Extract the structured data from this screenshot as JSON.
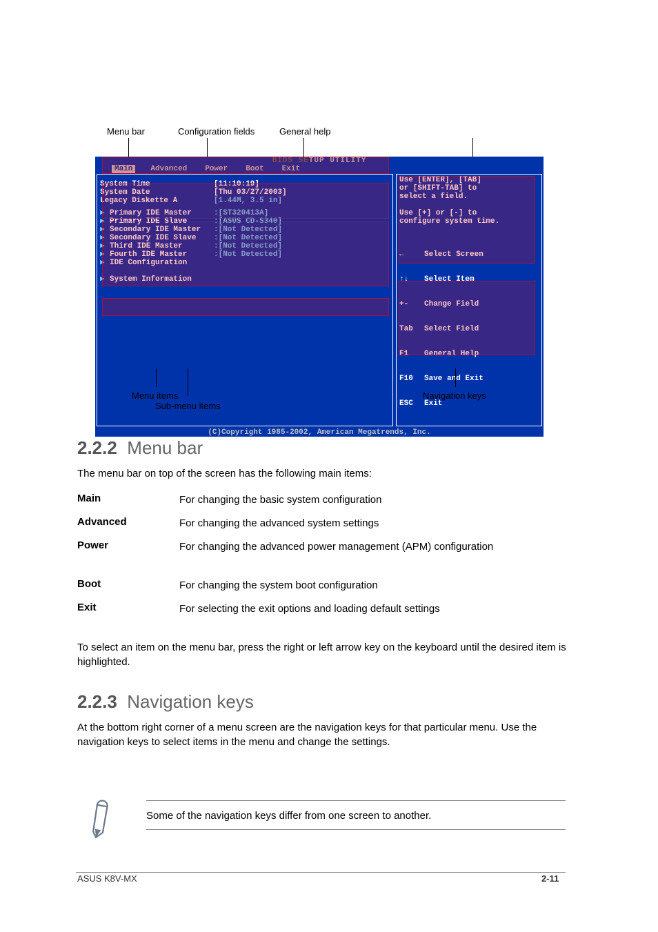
{
  "bios": {
    "title": "BIOS SETUP UTILITY",
    "menu": {
      "items": [
        "Main",
        "Advanced",
        "Power",
        "Boot",
        "Exit"
      ],
      "selected": 0
    },
    "rows_general": [
      {
        "label": "System Time",
        "value": "[11:10:19]"
      },
      {
        "label": "System Date",
        "value": "[Thu 03/27/2003]"
      },
      {
        "label": "Legacy Diskette A",
        "value": "[1.44M, 3.5 in]"
      }
    ],
    "rows_config": [
      {
        "label": "Primary IDE Master",
        "value": ":[ST320413A]"
      },
      {
        "label": "Primary IDE Slave",
        "value": ":[ASUS CD-S340]"
      },
      {
        "label": "Secondary IDE Master",
        "value": ":[Not Detected]"
      },
      {
        "label": "Secondary IDE Slave",
        "value": ":[Not Detected]"
      },
      {
        "label": "Third IDE Master",
        "value": ":[Not Detected]"
      },
      {
        "label": "Fourth IDE Master",
        "value": ":[Not Detected]"
      },
      {
        "label": "IDE Configuration",
        "value": ""
      }
    ],
    "rows_submenu": [
      {
        "label": "System Information",
        "value": ""
      }
    ],
    "help": "Use [ENTER], [TAB]\nor [SHIFT-TAB] to\nselect a field.\n\nUse [+] or [-] to\nconfigure system time.",
    "keys": [
      {
        "k": "←",
        "d": "Select Screen"
      },
      {
        "k": "↑↓",
        "d": "Select Item"
      },
      {
        "k": "+-",
        "d": "Change Field"
      },
      {
        "k": "Tab",
        "d": "Select Field"
      },
      {
        "k": "F1",
        "d": "General Help"
      },
      {
        "k": "F10",
        "d": "Save and Exit"
      },
      {
        "k": "ESC",
        "d": "Exit"
      }
    ],
    "footer": "(C)Copyright 1985-2002, American Megatrends, Inc."
  },
  "callouts": {
    "menubar": "Menu bar",
    "general_help": "General help",
    "config": "Configuration fields",
    "menu_items": "Menu items",
    "submenu": "Sub-menu items",
    "navkeys": "Navigation keys"
  },
  "section": {
    "num": "2.2.2",
    "title": "Menu bar",
    "intro": "The menu bar on top of the screen has the following main items:",
    "items": [
      {
        "name": "Main",
        "desc": "For changing the basic system configuration"
      },
      {
        "name": "Advanced",
        "desc": "For changing the advanced system settings"
      },
      {
        "name": "Power",
        "desc": "For changing the advanced power management (APM) configuration"
      },
      {
        "name": "Boot",
        "desc": "For changing the system boot configuration"
      },
      {
        "name": "Exit",
        "desc": "For selecting the exit options and loading default settings"
      }
    ],
    "tail": "To select an item on the menu bar, press the right or left arrow key on the keyboard until the desired item is highlighted."
  },
  "nav": {
    "num": "2.2.3",
    "title": "Navigation keys",
    "para": "At the bottom right corner of a menu screen are the navigation keys for that particular menu. Use the navigation keys to select items in the menu and change the settings."
  },
  "note": "Some of the navigation keys differ from one screen to another.",
  "footer": {
    "left": "ASUS K8V-MX",
    "right": "2-11"
  }
}
